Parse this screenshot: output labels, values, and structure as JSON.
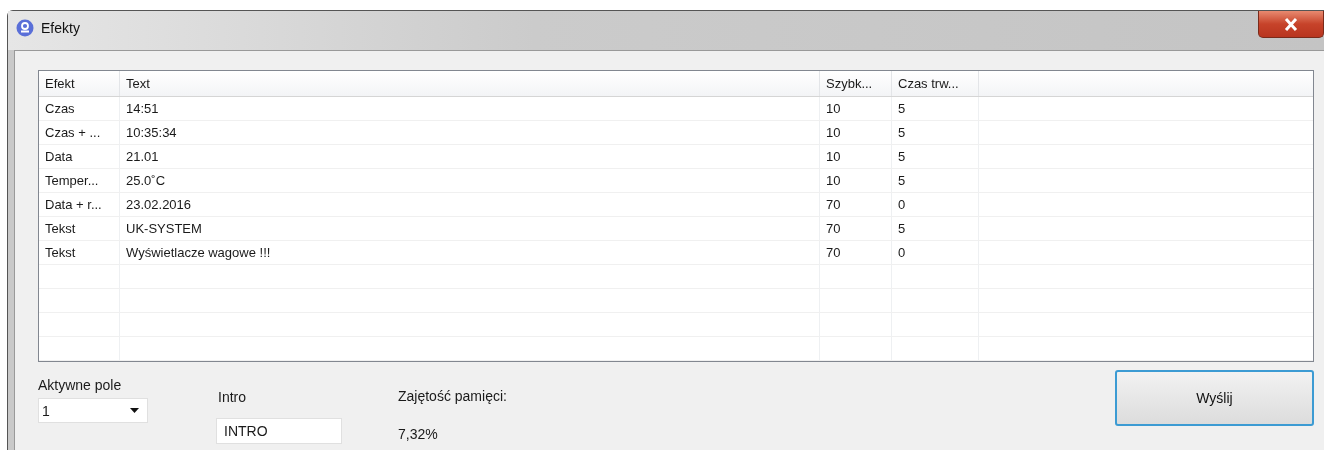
{
  "window": {
    "title": "Efekty"
  },
  "table": {
    "columns": [
      "Efekt",
      "Text",
      "Szybk...",
      "Czas trw..."
    ],
    "rows": [
      [
        "Czas",
        "14:51",
        "10",
        "5"
      ],
      [
        "Czas + ...",
        "10:35:34",
        "10",
        "5"
      ],
      [
        "Data",
        "21.01",
        "10",
        "5"
      ],
      [
        "Temper...",
        "25.0˚C",
        "10",
        "5"
      ],
      [
        "Data + r...",
        "23.02.2016",
        "70",
        "0"
      ],
      [
        "Tekst",
        "UK-SYSTEM",
        "70",
        "5"
      ],
      [
        "Tekst",
        "Wyświetlacze wagowe !!!",
        "70",
        "0"
      ]
    ]
  },
  "active_field": {
    "label": "Aktywne pole",
    "value": "1"
  },
  "intro": {
    "label": "Intro",
    "value": "INTRO"
  },
  "memory": {
    "label": "Zajętość pamięci:",
    "value": "7,32%"
  },
  "send_button": "Wyślij"
}
